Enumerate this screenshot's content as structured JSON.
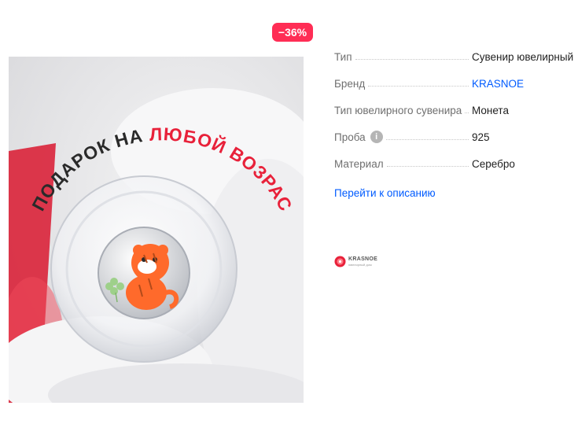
{
  "badge": {
    "discount": "−36%"
  },
  "image": {
    "banner_text_1": "ПОДАРОК НА ",
    "banner_text_2": "ЛЮБОЙ ВОЗРАСТ",
    "accent_color": "#e8213a"
  },
  "specs": [
    {
      "label": "Тип",
      "value": "Сувенир ювелирный",
      "is_link": false
    },
    {
      "label": "Бренд",
      "value": "KRASNOE",
      "is_link": true
    },
    {
      "label": "Тип ювелирного сувенира",
      "value": "Монета",
      "is_link": false
    },
    {
      "label": "Проба",
      "value": "925",
      "is_link": false,
      "info_icon": "i"
    },
    {
      "label": "Материал",
      "value": "Серебро",
      "is_link": false
    }
  ],
  "description_link": "Перейти к описанию",
  "brand_logo": {
    "name": "KRASNOE",
    "tagline": "ювелирный дом"
  },
  "colors": {
    "link": "#005bff",
    "badge": "#ff2d55"
  }
}
